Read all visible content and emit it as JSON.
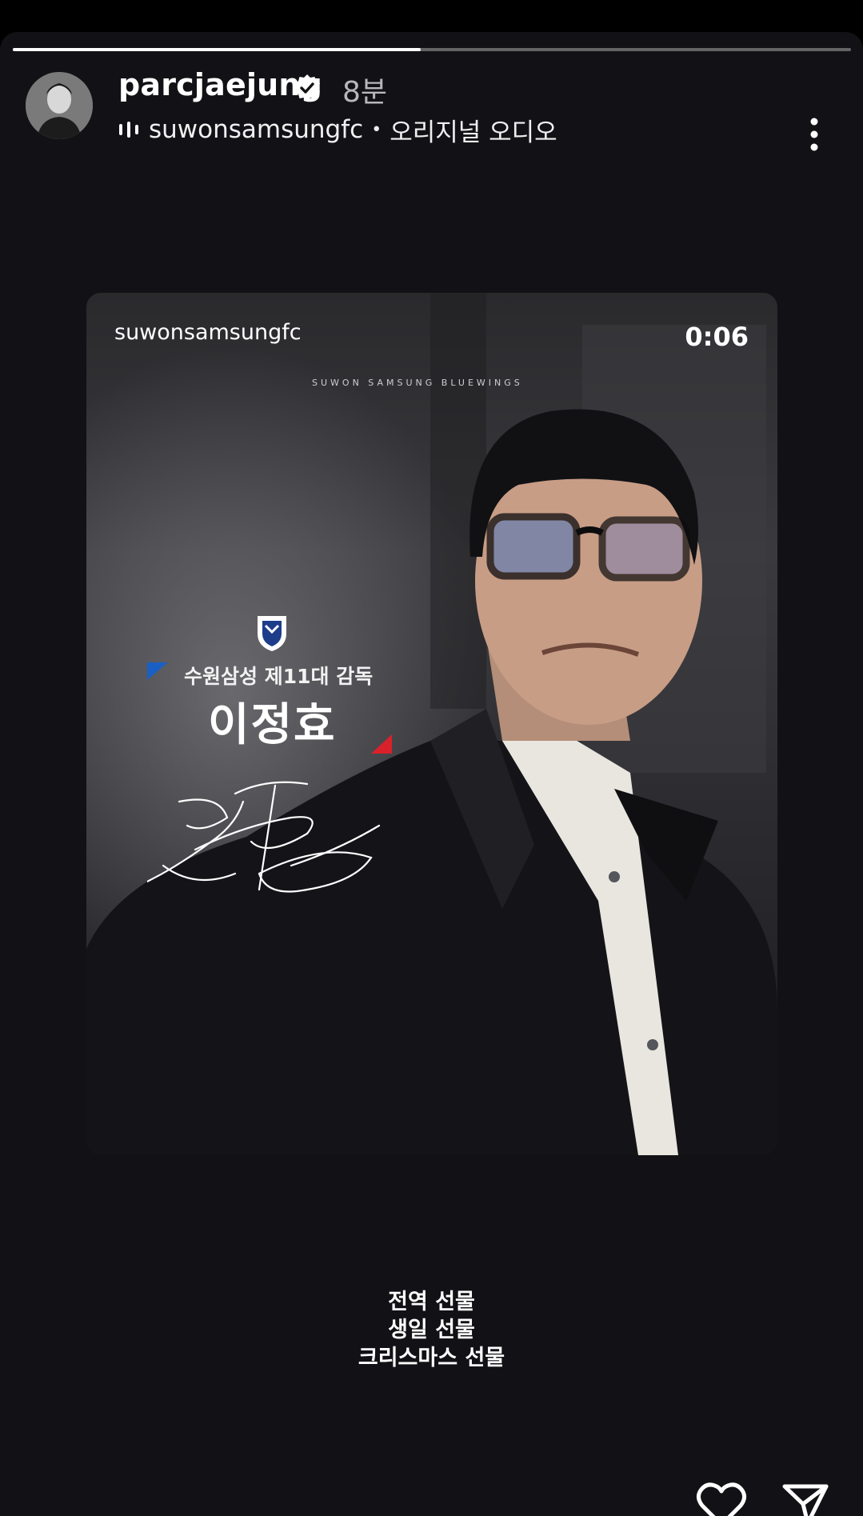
{
  "header": {
    "username": "parcjaejung",
    "time_ago": "8분",
    "audio_source": "suwonsamsungfc",
    "audio_separator": "•",
    "audio_label": "오리지널 오디오"
  },
  "progress": {
    "segments": 2,
    "current_segment_fraction": 1.0,
    "active_segment": 1
  },
  "media": {
    "owner": "suwonsamsungfc",
    "brand_line": "SUWON SAMSUNG BLUEWINGS",
    "duration": "0:06",
    "subtitle": "수원삼성 제11대 감독",
    "name": "이정효"
  },
  "caption": {
    "line1": "전역 선물",
    "line2": "생일 선물",
    "line3": "크리스마스 선물"
  },
  "icons": {
    "verified": "verified-badge-icon",
    "audio": "audio-bars-icon",
    "more": "more-options-icon",
    "like": "heart-icon",
    "share": "send-icon"
  },
  "colors": {
    "background": "#121216",
    "accent_blue": "#1a5fc4",
    "accent_red": "#d9212b"
  }
}
